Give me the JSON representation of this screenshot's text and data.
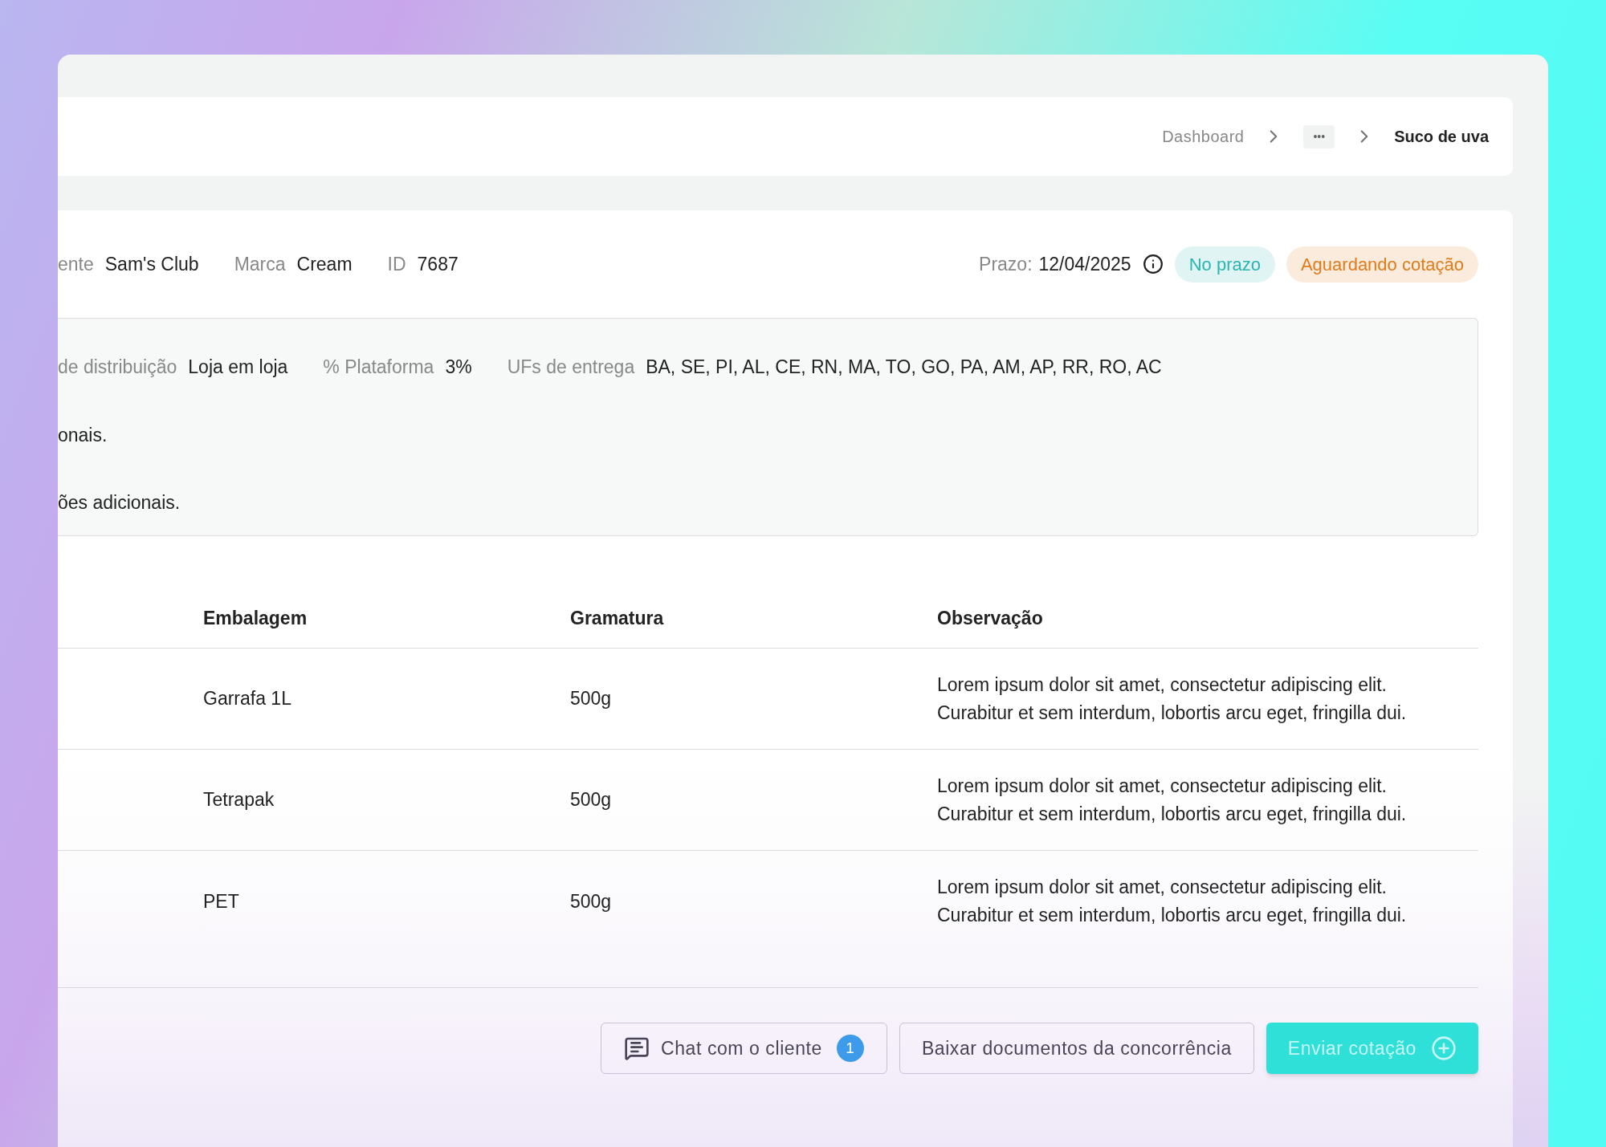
{
  "breadcrumb": [
    {
      "kind": "link",
      "label": "Dashboard"
    },
    {
      "kind": "ellipsis",
      "label": "•••"
    },
    {
      "kind": "current",
      "label": "Suco de uva"
    }
  ],
  "summary": {
    "fields": [
      {
        "label": "ente",
        "value": "Sam's Club"
      },
      {
        "label": "Marca",
        "value": "Cream"
      },
      {
        "label": "ID",
        "value": "7687"
      }
    ],
    "deadline": {
      "label": "Prazo:",
      "value": "12/04/2025"
    },
    "badges": [
      {
        "label": "No prazo",
        "color": "#2bb5b0"
      },
      {
        "label": "Aguardando cotação",
        "color": "#e07b1a"
      }
    ]
  },
  "details": {
    "fields": [
      {
        "label": "de distribuição",
        "value": "Loja em loja"
      },
      {
        "label": "% Plataforma",
        "value": "3%"
      },
      {
        "label": "UFs de entrega",
        "value": "BA, SE, PI, AL, CE, RN, MA, TO, GO, PA, AM, AP, RR, RO, AC"
      }
    ],
    "lines": [
      "onais.",
      "ões adicionais."
    ]
  },
  "table": {
    "columns": [
      "Embalagem",
      "Gramatura",
      "Observação"
    ],
    "rows": [
      [
        "Garrafa 1L",
        "500g",
        "Lorem ipsum dolor sit amet, consectetur adipiscing elit.\nCurabitur et sem interdum, lobortis arcu eget, fringilla dui."
      ],
      [
        "Tetrapak",
        "500g",
        "Lorem ipsum dolor sit amet, consectetur adipiscing elit.\nCurabitur et sem interdum, lobortis arcu eget, fringilla dui."
      ],
      [
        "PET",
        "500g",
        "Lorem ipsum dolor sit amet, consectetur adipiscing elit.\nCurabitur et sem interdum, lobortis arcu eget, fringilla dui."
      ]
    ]
  },
  "actions": [
    {
      "kind": "chat",
      "label": "Chat com o cliente",
      "count": "1"
    },
    {
      "kind": "outline",
      "label": "Baixar documentos da concorrência"
    },
    {
      "kind": "primary",
      "label": "Enviar cotação"
    }
  ]
}
